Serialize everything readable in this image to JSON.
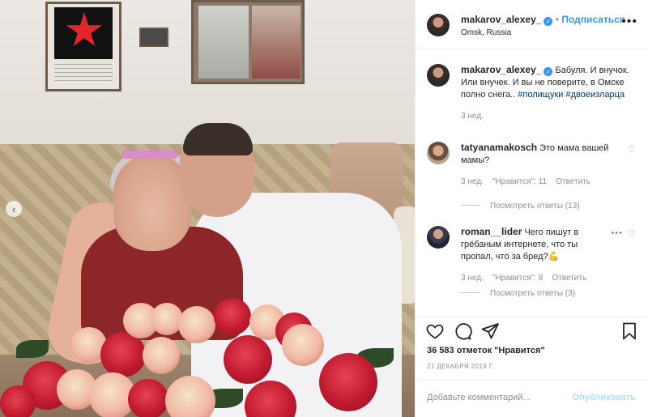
{
  "post": {
    "author": "makarov_alexey_",
    "follow_label": "Подписаться",
    "location": "Omsk, Russia",
    "caption": "Бабуля. И внучок. Или внучек. И вы не поверите, в Омске полно снега..",
    "hashtags": "#полищуки #двоеизларца",
    "caption_age": "3 нед."
  },
  "comments": [
    {
      "user": "tatyanamakosch",
      "text": "Это мама вашей мамы?",
      "age": "3 нед.",
      "likes": "\"Нравится\": 11",
      "reply": "Ответить",
      "view_replies": "Посмотреть ответы (13)"
    },
    {
      "user": "roman__lider",
      "text": "Чего пишут в грёбаным интернете, что ты пропал, что за бред?💪",
      "age": "3 нед.",
      "likes": "\"Нравится\": 8",
      "reply": "Ответить",
      "view_replies": "Посмотреть ответы (3)"
    }
  ],
  "footer": {
    "likes_text": "36 583 отметок \"Нравится\"",
    "date": "21 ДЕКАБРЯ 2019 Г.",
    "comment_placeholder": "Добавьте комментарий...",
    "publish_label": "Опубликовать"
  },
  "icons": {
    "like": "heart-icon",
    "comment": "comment-bubble-icon",
    "share": "paper-plane-icon",
    "save": "bookmark-icon",
    "more": "more-dots-icon",
    "verified": "verified-badge-icon",
    "prev": "chevron-left-icon"
  },
  "colors": {
    "link_blue": "#3897f0",
    "text": "#262626",
    "muted": "#8e8e8e",
    "border": "#efefef"
  }
}
